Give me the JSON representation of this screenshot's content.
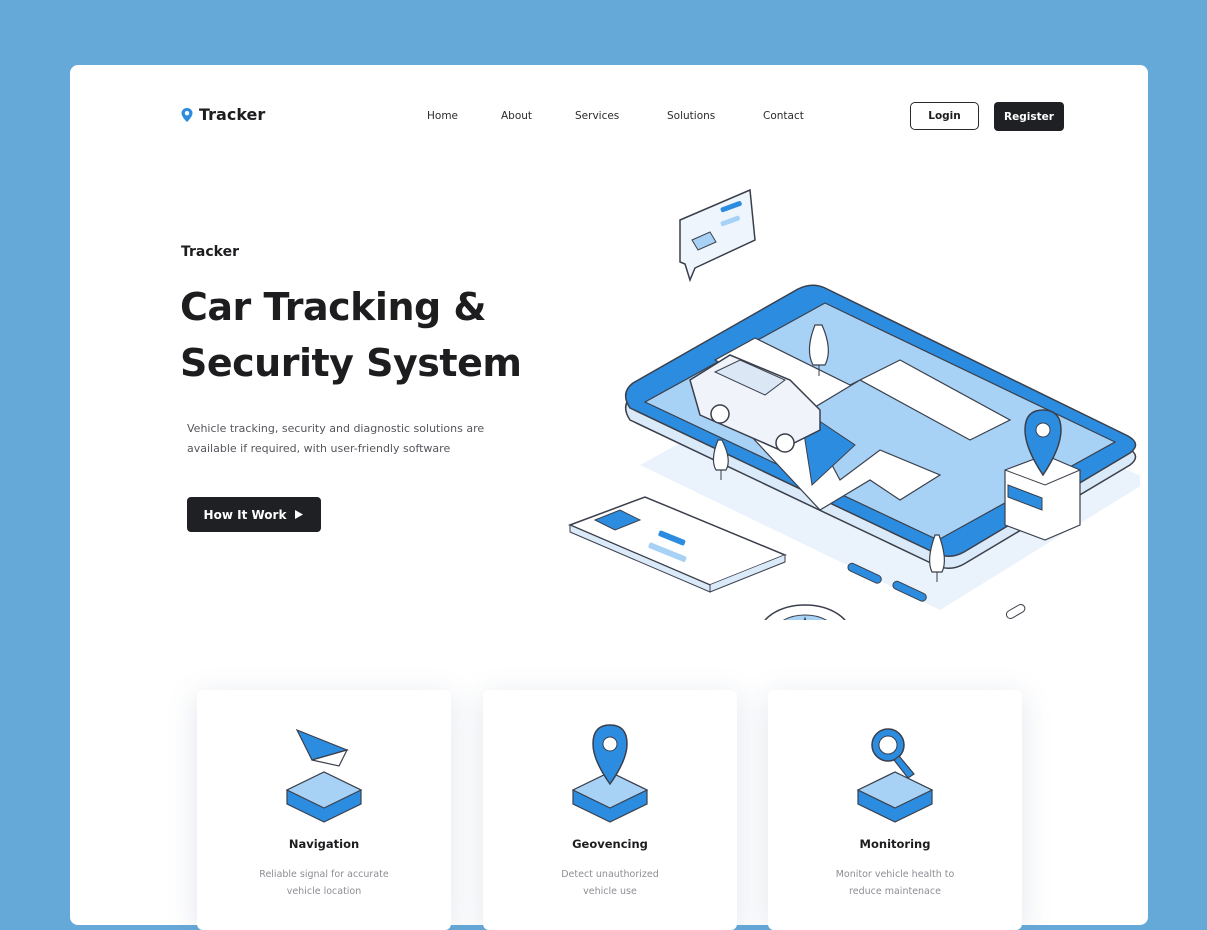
{
  "brand": {
    "name": "Tracker",
    "icon": "location-pin-icon"
  },
  "nav": {
    "items": [
      "Home",
      "About",
      "Services",
      "Solutions",
      "Contact"
    ]
  },
  "auth": {
    "login": "Login",
    "register": "Register"
  },
  "hero": {
    "eyebrow": "Tracker",
    "title_line1": "Car Tracking &",
    "title_line2": "Security System",
    "desc_line1": "Vehicle tracking, security and diagnostic solutions are",
    "desc_line2": "available if required, with user-friendly software",
    "cta": "How It Work",
    "cta_icon": "play-arrow-icon"
  },
  "features": [
    {
      "title": "Navigation",
      "line1": "Reliable signal for accurate",
      "line2": "vehicle location",
      "icon": "navigation-arrow-icon"
    },
    {
      "title": "Geovencing",
      "line1": "Detect unauthorized",
      "line2": "vehicle use",
      "icon": "map-pin-icon"
    },
    {
      "title": "Monitoring",
      "line1": "Monitor vehicle health to",
      "line2": "reduce maintenace",
      "icon": "magnifier-icon"
    }
  ],
  "colors": {
    "background": "#65a9d8",
    "accent": "#2c8de0",
    "dark": "#1f2024"
  }
}
